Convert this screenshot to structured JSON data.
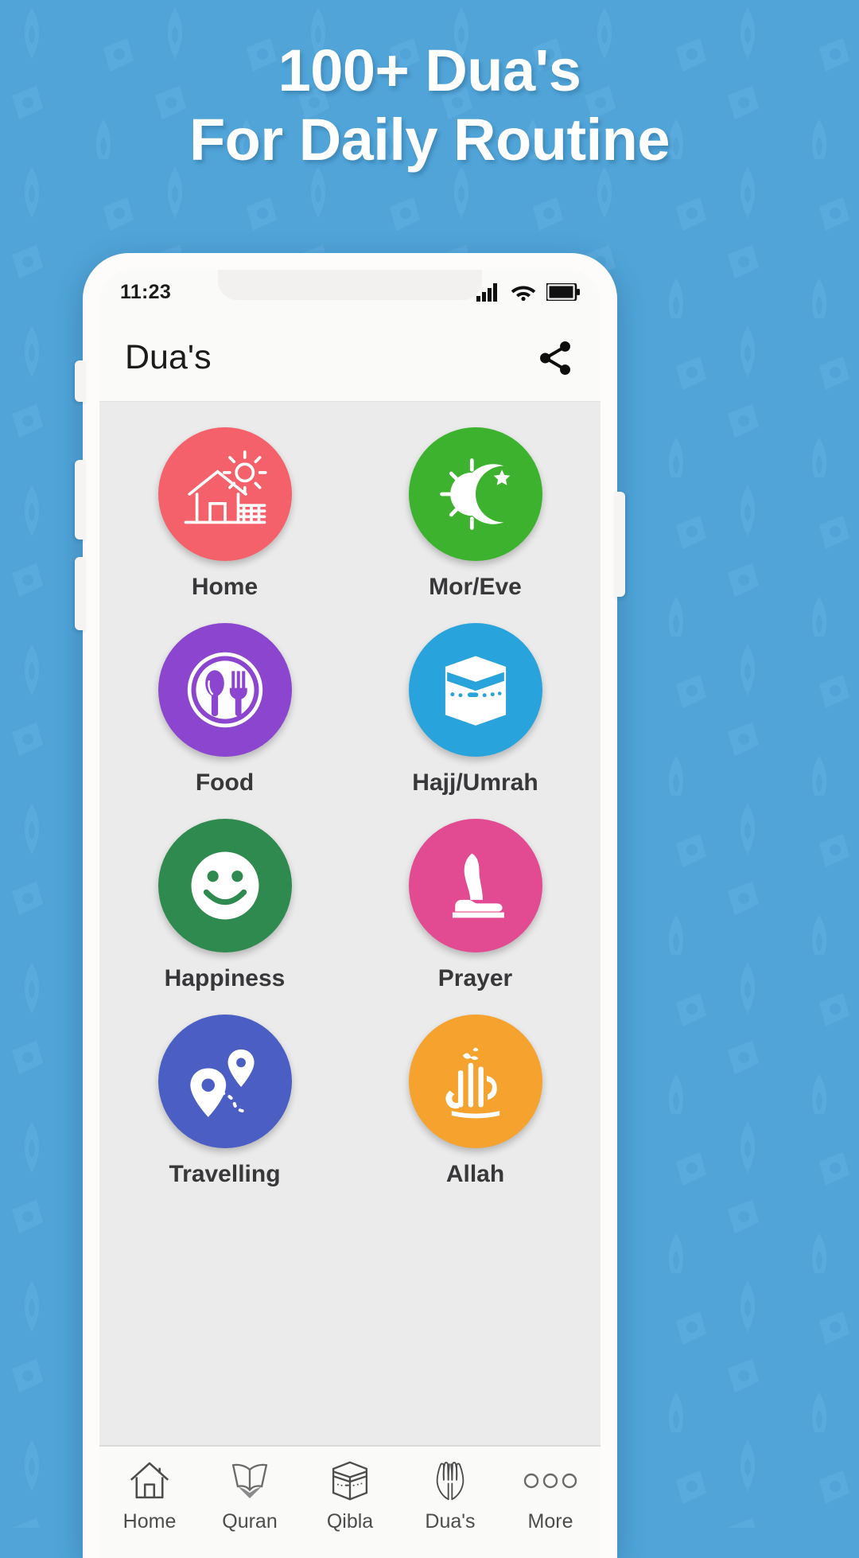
{
  "promo": {
    "headline_line1": "100+ Dua's",
    "headline_line2": "For Daily Routine",
    "background_color": "#50a4d8",
    "headline_color": "#ffffff"
  },
  "phone": {
    "statusbar": {
      "time": "11:23",
      "icons": [
        "signal-icon",
        "wifi-icon",
        "battery-icon"
      ]
    },
    "appbar": {
      "title": "Dua's",
      "action_icon": "share-icon"
    },
    "grid": {
      "items": [
        {
          "label": "Home",
          "icon": "house-sun-icon",
          "color": "#f4616b"
        },
        {
          "label": "Mor/Eve",
          "icon": "sun-moon-icon",
          "color": "#3cb22e"
        },
        {
          "label": "Food",
          "icon": "plate-cutlery-icon",
          "color": "#8b45ce"
        },
        {
          "label": "Hajj/Umrah",
          "icon": "kaaba-icon",
          "color": "#29a3dc"
        },
        {
          "label": "Happiness",
          "icon": "smiley-icon",
          "color": "#2f8a4f"
        },
        {
          "label": "Prayer",
          "icon": "praying-person-icon",
          "color": "#e24b92"
        },
        {
          "label": "Travelling",
          "icon": "map-pins-icon",
          "color": "#4a5ec4"
        },
        {
          "label": "Allah",
          "icon": "allah-calligraphy-icon",
          "color": "#f5a22e"
        }
      ]
    },
    "bottomnav": {
      "items": [
        {
          "label": "Home",
          "icon": "home-outline-icon"
        },
        {
          "label": "Quran",
          "icon": "quran-book-icon"
        },
        {
          "label": "Qibla",
          "icon": "kaaba-outline-icon"
        },
        {
          "label": "Dua's",
          "icon": "praying-hands-icon"
        },
        {
          "label": "More",
          "icon": "three-dots-icon"
        }
      ]
    }
  }
}
